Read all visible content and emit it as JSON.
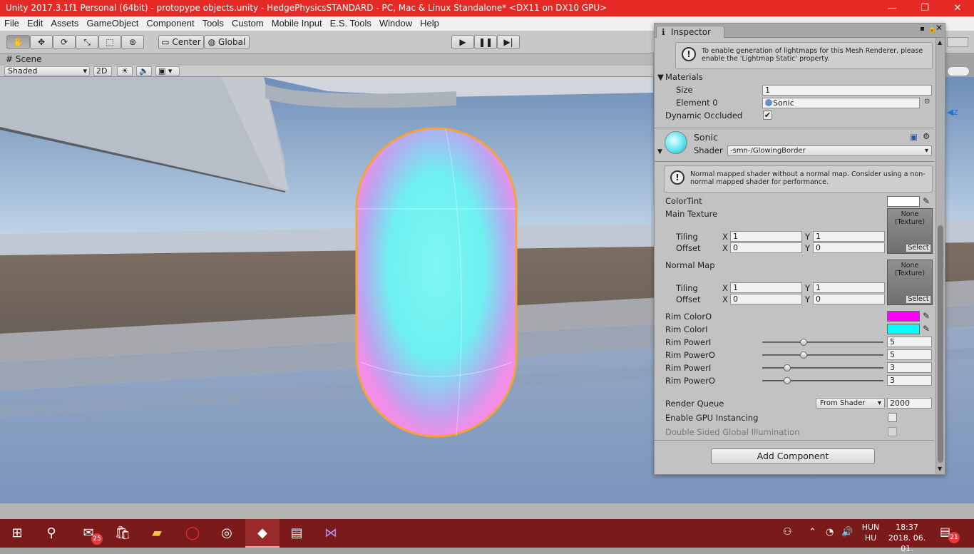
{
  "window": {
    "title": "Unity 2017.3.1f1 Personal (64bit) - protopype objects.unity - HedgePhysicsSTANDARD - PC, Mac & Linux Standalone* <DX11 on DX10 GPU>",
    "controls": [
      "—",
      "❐",
      "✕"
    ]
  },
  "menu": [
    "File",
    "Edit",
    "Assets",
    "GameObject",
    "Component",
    "Tools",
    "Custom",
    "Mobile Input",
    "E.S. Tools",
    "Window",
    "Help"
  ],
  "toolbar": {
    "pivot_label": "Center",
    "space_label": "Global"
  },
  "scene": {
    "tab_label": "Scene",
    "shading_mode": "Shaded",
    "mode_2d": "2D"
  },
  "inspector": {
    "tab_label": "Inspector",
    "lightmap_help": "To enable generation of lightmaps for this Mesh Renderer, please enable the 'Lightmap Static' property.",
    "materials_label": "Materials",
    "size_label": "Size",
    "size_value": "1",
    "element0_label": "Element 0",
    "element0_value": "Sonic",
    "dynamic_occluded_label": "Dynamic Occluded",
    "dynamic_occluded_checked": true,
    "material_name": "Sonic",
    "shader_label": "Shader",
    "shader_value": "-smn-/GlowingBorder",
    "normal_help": "Normal mapped shader without a normal map. Consider using a non-normal mapped shader for performance.",
    "colortint_label": "ColorTint",
    "colortint_color": "#ffffff",
    "main_texture_label": "Main Texture",
    "normal_map_label": "Normal Map",
    "tiling_label": "Tiling",
    "offset_label": "Offset",
    "x_label": "X",
    "y_label": "Y",
    "main_tiling_x": "1",
    "main_tiling_y": "1",
    "main_offset_x": "0",
    "main_offset_y": "0",
    "normal_tiling_x": "1",
    "normal_tiling_y": "1",
    "normal_offset_x": "0",
    "normal_offset_y": "0",
    "texture_none": "None",
    "texture_type": "(Texture)",
    "texture_select": "Select",
    "rim_color_o_label": "Rim ColorO",
    "rim_color_o": "#ff00ff",
    "rim_color_i_label": "Rim ColorI",
    "rim_color_i": "#00ffff",
    "rim_power_i1_label": "Rim PowerI",
    "rim_power_i1_value": "5",
    "rim_power_o1_label": "Rim PowerO",
    "rim_power_o1_value": "5",
    "rim_power_i2_label": "Rim PowerI",
    "rim_power_i2_value": "3",
    "rim_power_o2_label": "Rim PowerO",
    "rim_power_o2_value": "3",
    "render_queue_label": "Render Queue",
    "render_queue_mode": "From Shader",
    "render_queue_value": "2000",
    "gpu_instancing_label": "Enable GPU Instancing",
    "double_sided_gi_label": "Double Sided Global Illumination",
    "add_component_label": "Add Component"
  },
  "taskbar": {
    "language_top": "HUN",
    "language_bottom": "HU",
    "time": "18:37",
    "date": "2018. 06. 01.",
    "mail_badge": "25",
    "notification_badge": "21"
  }
}
